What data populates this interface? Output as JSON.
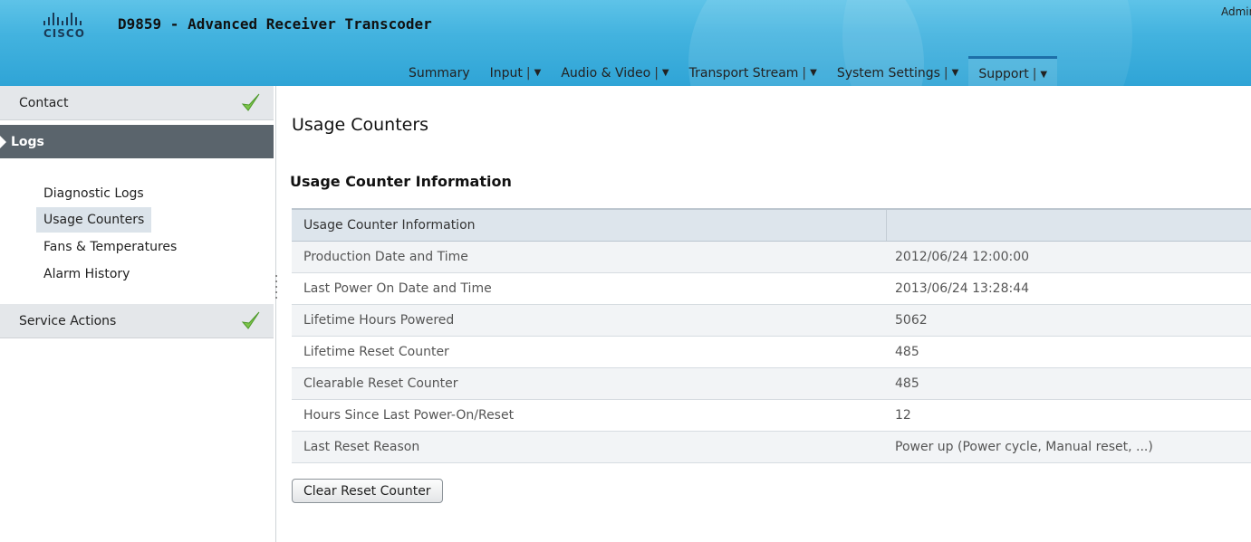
{
  "app": {
    "brand": "cisco",
    "title": "D9859 - Advanced Receiver Transcoder",
    "user": "Admin"
  },
  "nav": {
    "items": [
      {
        "label": "Summary"
      },
      {
        "label": "Input",
        "sep": "|",
        "arrow": "▼"
      },
      {
        "label": "Audio & Video",
        "sep": "|",
        "arrow": "▼"
      },
      {
        "label": "Transport Stream",
        "sep": "|",
        "arrow": "▼"
      },
      {
        "label": "System Settings",
        "sep": "|",
        "arrow": "▼"
      },
      {
        "label": "Support",
        "sep": "|",
        "arrow": "▼",
        "active": true
      }
    ]
  },
  "sidebar": {
    "contact": "Contact",
    "logs": "Logs",
    "sub_items": [
      {
        "label": "Diagnostic Logs"
      },
      {
        "label": "Usage Counters",
        "selected": true
      },
      {
        "label": "Fans & Temperatures"
      },
      {
        "label": "Alarm History"
      }
    ],
    "service_actions": "Service Actions",
    "check_icon": "checkmark-icon",
    "check_color": "#7cc44a"
  },
  "main": {
    "page_title": "Usage Counters",
    "section_title": "Usage Counter Information",
    "table": {
      "header": [
        "Usage Counter Information",
        ""
      ],
      "rows": [
        [
          "Production Date and Time",
          "2012/06/24 12:00:00"
        ],
        [
          "Last Power On Date and Time",
          "2013/06/24 13:28:44"
        ],
        [
          "Lifetime Hours Powered",
          "5062"
        ],
        [
          "Lifetime Reset Counter",
          "485"
        ],
        [
          "Clearable Reset Counter",
          "485"
        ],
        [
          "Hours Since Last Power-On/Reset",
          "12"
        ],
        [
          "Last Reset Reason",
          "Power up (Power cycle, Manual reset, ...)"
        ]
      ]
    },
    "clear_button": "Clear Reset Counter"
  },
  "colors": {
    "header_top": "#5ec3e8",
    "header_bottom": "#2fa4d6",
    "sidebar_active": "#5a646c",
    "table_header": "#dde5ec"
  }
}
